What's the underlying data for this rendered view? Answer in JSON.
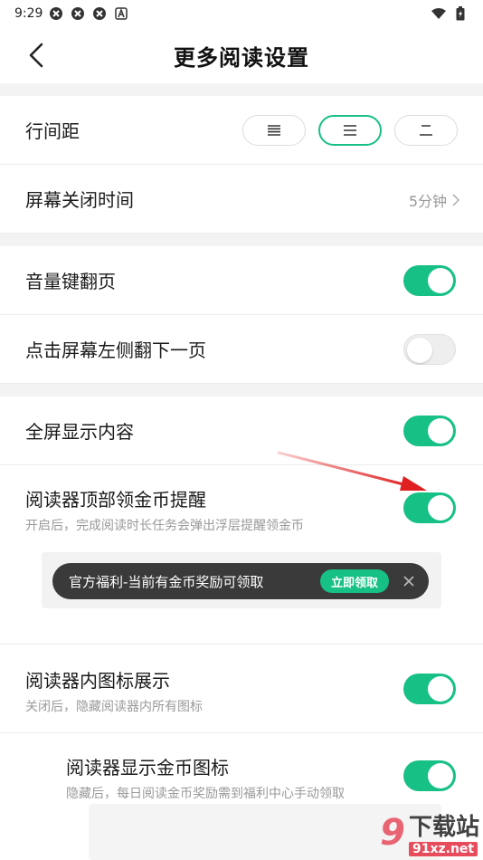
{
  "status_bar": {
    "time": "9:29"
  },
  "header": {
    "title": "更多阅读设置"
  },
  "settings": {
    "line_spacing": {
      "label": "行间距"
    },
    "screen_off": {
      "label": "屏幕关闭时间",
      "value": "5分钟"
    },
    "volume_key": {
      "label": "音量键翻页",
      "state": true
    },
    "tap_left": {
      "label": "点击屏幕左侧翻下一页",
      "state": false
    },
    "fullscreen": {
      "label": "全屏显示内容",
      "state": true
    },
    "coin_reminder": {
      "label": "阅读器顶部领金币提醒",
      "desc": "开启后，完成阅读时长任务会弹出浮层提醒领金币",
      "state": true
    },
    "icon_display": {
      "label": "阅读器内图标展示",
      "desc": "关闭后，隐藏阅读器内所有图标",
      "state": true
    },
    "coin_icon": {
      "label": "阅读器显示金币图标",
      "desc": "隐藏后，每日阅读金币奖励需到福利中心手动领取",
      "state": true
    }
  },
  "toast": {
    "text": "官方福利-当前有金币奖励可领取",
    "button": "立即领取"
  },
  "watermark": {
    "logo": "9",
    "main": "下载站",
    "url": "91xz.net"
  },
  "colors": {
    "accent": "#17c085",
    "arrow": "#e02020"
  }
}
